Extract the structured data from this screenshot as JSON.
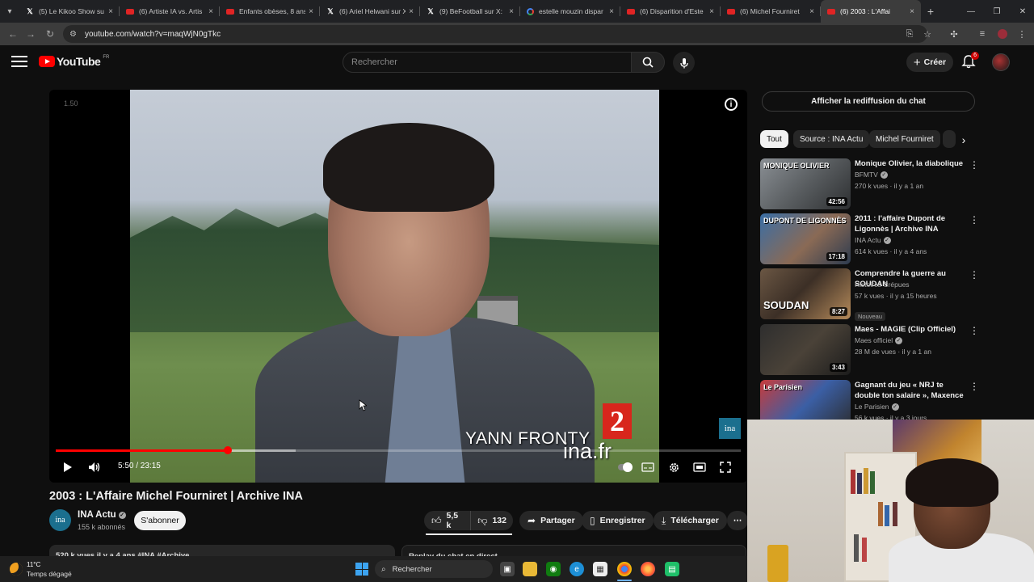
{
  "browser": {
    "tabs": [
      {
        "icon": "x-icon",
        "title": "(5) Le Kikoo Show su"
      },
      {
        "icon": "youtube-icon",
        "title": "(6) Artiste IA vs. Artis"
      },
      {
        "icon": "youtube-icon",
        "title": "Enfants obèses, 8 ans"
      },
      {
        "icon": "x-icon",
        "title": "(6) Ariel Helwani sur X"
      },
      {
        "icon": "x-icon",
        "title": "(9) BeFootball sur X:"
      },
      {
        "icon": "google-icon",
        "title": "estelle mouzin dispar"
      },
      {
        "icon": "youtube-icon",
        "title": "(6) Disparition d'Este"
      },
      {
        "icon": "youtube-icon",
        "title": "(6) Michel Fourniret"
      },
      {
        "icon": "youtube-icon",
        "title": "(6) 2003 : L'Affai"
      }
    ],
    "active_tab_index": 8,
    "url": "youtube.com/watch?v=maqWjN0gTkc"
  },
  "masthead": {
    "logo_text": "YouTube",
    "country_code": "FR",
    "search_placeholder": "Rechercher",
    "create_label": "Créer",
    "notification_count": "6"
  },
  "player": {
    "overlay_timestamp": "1.50",
    "lower_third_name": "YANN FRONTY",
    "channel_number": "2",
    "watermark": "ina.fr",
    "corner_badge": "ina",
    "time_current": "5:50",
    "time_total": "23:15",
    "time_display": "5:50 / 23:15",
    "played_fraction": 0.251,
    "buffered_fraction": 0.35
  },
  "video": {
    "title": "2003 : L'Affaire Michel Fourniret | Archive INA",
    "channel_name": "INA Actu",
    "channel_avatar_text": "ina",
    "subscribers": "155 k abonnés",
    "subscribe_label": "S'abonner",
    "likes": "5,5 k",
    "dislikes": "132",
    "share_label": "Partager",
    "save_label": "Enregistrer",
    "download_label": "Télécharger",
    "description_peek": "520 k vues  il y a 4 ans  #INA #Archive",
    "chat_replay_peek": "Replay du chat en direct"
  },
  "sidebar": {
    "chat_replay_button": "Afficher la rediffusion du chat",
    "chips": [
      "Tout",
      "Source : INA Actu",
      "Michel Fourniret"
    ],
    "recommendations": [
      {
        "title": "Monique Olivier, la diabolique",
        "channel": "BFMTV",
        "verified": true,
        "stats": "270 k vues · il y a 1 an",
        "duration": "42:56",
        "thumb_text": "MONIQUE OLIVIER",
        "badge": ""
      },
      {
        "title": "2011 : l'affaire Dupont de Ligonnès | Archive INA",
        "channel": "INA Actu",
        "verified": true,
        "stats": "614 k vues · il y a 4 ans",
        "duration": "17:18",
        "thumb_text": "DUPONT DE LIGONNÈS",
        "badge": ""
      },
      {
        "title": "Comprendre la guerre au SOUDAN",
        "channel": "Histoires Crépues",
        "verified": false,
        "stats": "57 k vues · il y a 15 heures",
        "duration": "8:27",
        "thumb_text": "SOUDAN",
        "badge": "Nouveau"
      },
      {
        "title": "Maes - MAGIE (Clip Officiel)",
        "channel": "Maes officiel",
        "verified": true,
        "stats": "28 M de vues · il y a 1 an",
        "duration": "3:43",
        "thumb_text": "",
        "badge": ""
      },
      {
        "title": "Gagnant du jeu « NRJ te double ton salaire », Maxence se voit ...",
        "channel": "Le Parisien",
        "verified": true,
        "stats": "56 k vues · il y a 3 jours",
        "duration": "",
        "thumb_text": "Le Parisien",
        "badge": ""
      }
    ]
  },
  "taskbar": {
    "temperature": "11°C",
    "weather": "Temps dégagé",
    "search_placeholder": "Rechercher"
  },
  "colors": {
    "youtube_red": "#ff0000",
    "background": "#0f0f0f",
    "chip_active": "#f1f1f1",
    "ina_blue": "#1b6f8e"
  }
}
